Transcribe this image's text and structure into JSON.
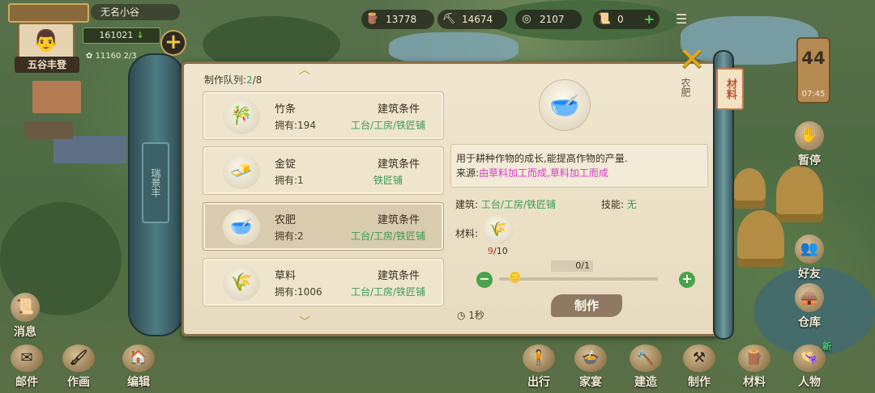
{
  "player": {
    "name": "无名小谷",
    "title": "五谷丰登",
    "fame": "161021",
    "population": "11160",
    "population_extra": "2/3"
  },
  "resources": [
    {
      "icon": "wood-log-icon",
      "glyph": "🪵",
      "value": "13778"
    },
    {
      "icon": "stone-tool-icon",
      "glyph": "⛏",
      "value": "14674"
    },
    {
      "icon": "copper-coin-icon",
      "glyph": "◎",
      "value": "2107"
    },
    {
      "icon": "scroll-token-icon",
      "glyph": "📜",
      "value": "0"
    }
  ],
  "day_tag": {
    "day": "44",
    "clock": "07:45"
  },
  "left_nav": {
    "mail": "邮件",
    "paint": "作画",
    "edit": "编辑",
    "message": "消息"
  },
  "right_nav": {
    "pause": "暂停",
    "friends": "好友",
    "warehouse": "仓库",
    "people": "人物",
    "new_badge": "新"
  },
  "bottom_nav": {
    "travel": "出行",
    "banquet": "家宴",
    "build": "建造",
    "craft": "制作",
    "material": "材料",
    "people": "人物"
  },
  "scroll": {
    "rod_plaque": "瑞景丰",
    "material_tab": "材料",
    "fertilizer_tab": "农肥"
  },
  "queue": {
    "label": "制作队列:",
    "current": "2",
    "sep": "/",
    "max": "8"
  },
  "recipes": [
    {
      "name": "竹条",
      "own": "拥有:194",
      "cond": "建筑条件",
      "req": "工台/工房/铁匠铺",
      "glyph": "🎋"
    },
    {
      "name": "金锭",
      "own": "拥有:1",
      "cond": "建筑条件",
      "req": "铁匠铺",
      "glyph": "🧈"
    },
    {
      "name": "农肥",
      "own": "拥有:2",
      "cond": "建筑条件",
      "req": "工台/工房/铁匠铺",
      "glyph": "🥣"
    },
    {
      "name": "草料",
      "own": "拥有:1006",
      "cond": "建筑条件",
      "req": "工台/工房/铁匠铺",
      "glyph": "🌾"
    }
  ],
  "detail": {
    "desc": "用于耕种作物的成长,能提高作物的产量.",
    "source_label": "来源:",
    "source": "由草料加工而成,草料加工而成",
    "building_label": "建筑: ",
    "building": "工台/工房/铁匠铺",
    "skill_label": "技能: ",
    "skill": "无",
    "material_label": "材料:",
    "material_have": "9",
    "material_need": "/10",
    "qty": "0/1",
    "make_btn": "制作",
    "time": "1秒"
  }
}
